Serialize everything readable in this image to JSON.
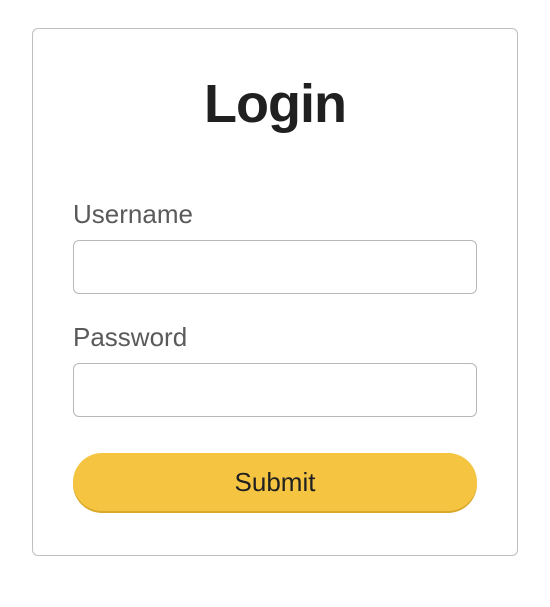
{
  "form": {
    "title": "Login",
    "username": {
      "label": "Username",
      "value": ""
    },
    "password": {
      "label": "Password",
      "value": ""
    },
    "submit_label": "Submit"
  }
}
